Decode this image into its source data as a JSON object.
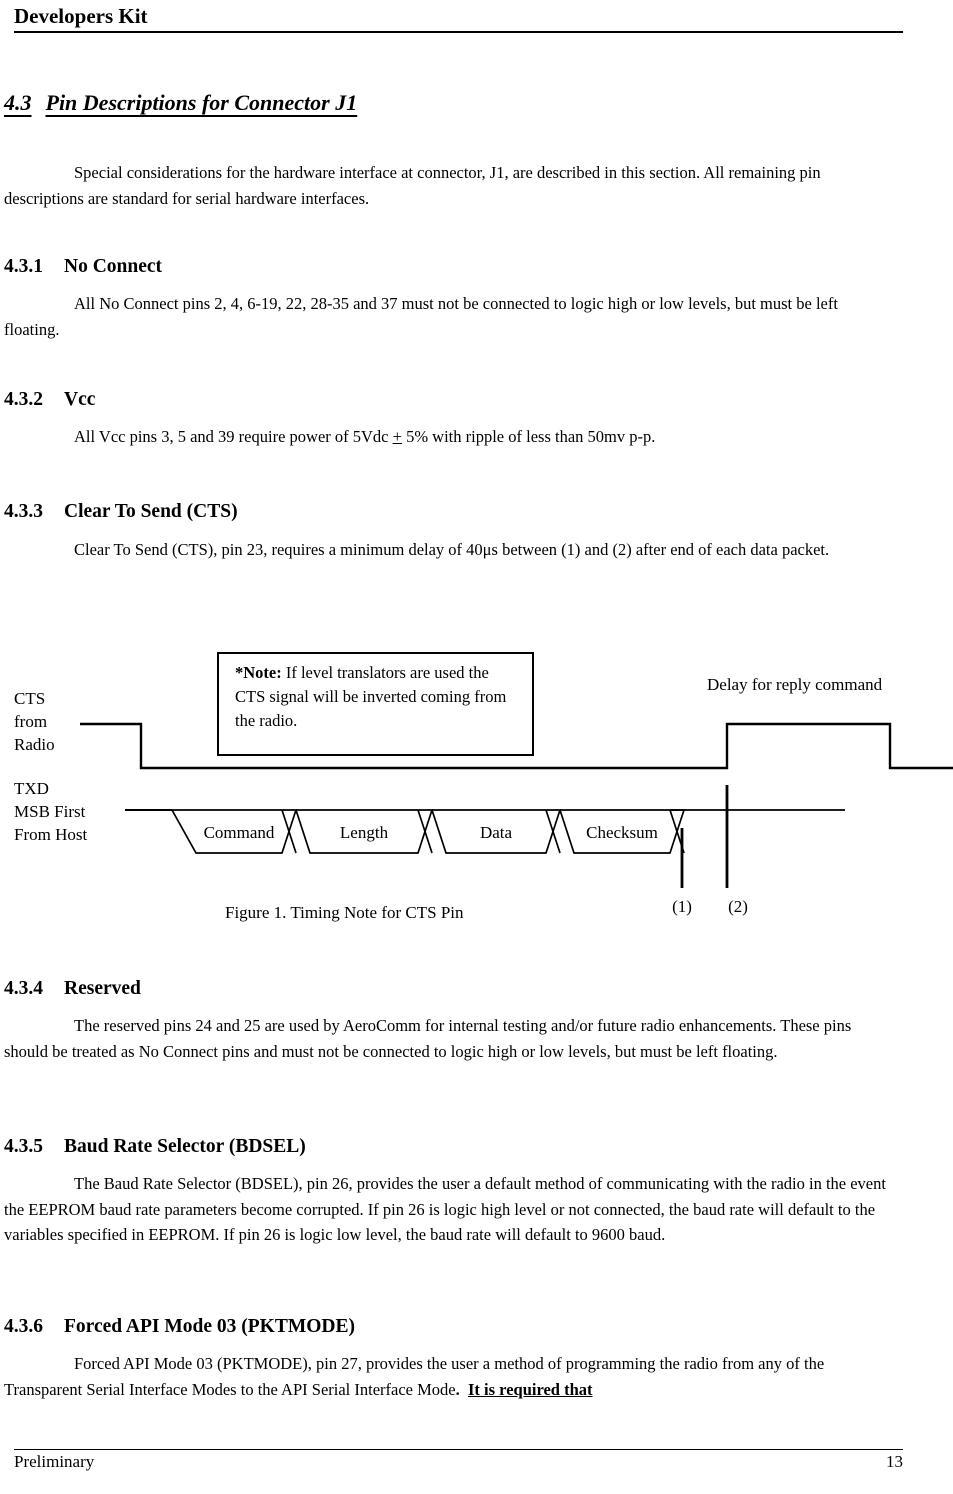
{
  "header": {
    "title": "Developers Kit"
  },
  "section": {
    "number": "4.3",
    "title": "Pin Descriptions for Connector J1",
    "intro": "Special considerations for the hardware interface at connector, J1, are described in this section. All remaining pin descriptions are standard for serial hardware interfaces."
  },
  "subsections": [
    {
      "number": "4.3.1",
      "title": "No Connect",
      "body": "All No Connect pins 2, 4, 6-19, 22, 28-35 and 37 must not be connected to logic high or low levels, but must be left floating."
    },
    {
      "number": "4.3.2",
      "title": "Vcc",
      "body_pre": "All Vcc pins 3, 5 and 39 require power of 5Vdc ",
      "body_underline": "+",
      "body_post": " 5% with ripple of less than 50mv p-p."
    },
    {
      "number": "4.3.3",
      "title": "Clear To Send (CTS)",
      "body": "Clear To Send (CTS), pin 23, requires a minimum delay of 40μs between (1) and (2) after end of each data packet."
    },
    {
      "number": "4.3.4",
      "title": "Reserved",
      "body": "The reserved pins 24 and 25 are used by AeroComm for internal testing and/or future radio enhancements.  These pins should be treated as No Connect pins and must not be connected to logic high or low levels, but must be left floating."
    },
    {
      "number": "4.3.5",
      "title": "Baud Rate Selector (BDSEL)",
      "body": "The Baud Rate Selector (BDSEL), pin 26, provides the user a default method of communicating with the radio in the event the EEPROM baud rate parameters become corrupted.  If pin 26 is logic high level or not connected, the baud rate will default to the variables specified in EEPROM.  If pin 26 is logic low level, the baud rate will default to 9600 baud."
    },
    {
      "number": "4.3.6",
      "title_pre": "Forced API Mode 03 ",
      "title_post": "(PKTMODE)",
      "body_pre": "Forced API Mode 03 (PKTMODE), pin 27, provides the user a method of programming the radio from any of the Transparent Serial Interface Modes to the API Serial Interface Mode",
      "body_bold": ".",
      "body_bold_underline": "It is required that"
    }
  ],
  "figure": {
    "caption": "Figure 1.  Timing Note for CTS Pin",
    "note_bold": "*Note:",
    "note_text": " If level translators are used the CTS signal will be inverted coming from the radio.",
    "cts_label_lines": [
      "CTS",
      "from",
      "Radio"
    ],
    "txd_label_lines": [
      "TXD",
      "MSB First",
      "From Host"
    ],
    "delay_label": "Delay for reply command",
    "packet_fields": [
      "Command",
      "Length",
      "Data",
      "Checksum"
    ],
    "markers": [
      "(1)",
      "(2)"
    ]
  },
  "footer": {
    "left": "Preliminary",
    "right": "13"
  },
  "colors": {
    "ink": "#000000",
    "paper": "#ffffff"
  }
}
